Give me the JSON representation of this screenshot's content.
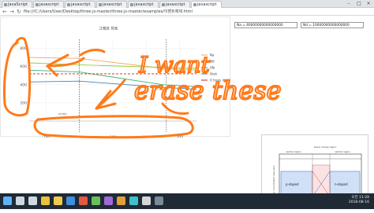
{
  "browser": {
    "tabs": [
      {
        "label": "JavaScript",
        "active": false
      },
      {
        "label": "javascript",
        "active": false
      },
      {
        "label": "javascript",
        "active": false
      },
      {
        "label": "javascript",
        "active": false
      },
      {
        "label": "javascript",
        "active": false
      },
      {
        "label": "javascript",
        "active": false
      },
      {
        "label": "javascript",
        "active": true
      }
    ],
    "address": "file:///C:/Users/User/Desktop/three.js-master/three.js-master/examples/이벤트예제.html",
    "window_controls": {
      "minimize": "–",
      "maximize": "□",
      "close": "×"
    },
    "nav": {
      "back": "←",
      "forward": "→",
      "reload": "↻"
    }
  },
  "chart_data": {
    "type": "line",
    "title": "그래프 차트",
    "x_ticks": [
      "-100",
      "0",
      "100",
      "200",
      "300"
    ],
    "y_ticks": [
      "800",
      "600",
      "400",
      "200"
    ],
    "xlim": [
      -150,
      350
    ],
    "ylim": [
      0,
      900
    ],
    "series": [
      {
        "name": "Na",
        "color": "#f4a460",
        "points": [
          [
            -150,
            700
          ],
          [
            0,
            690
          ],
          [
            250,
            580
          ],
          [
            350,
            560
          ]
        ]
      },
      {
        "name": "Nd",
        "color": "#9acd32",
        "points": [
          [
            -150,
            640
          ],
          [
            0,
            620
          ],
          [
            250,
            590
          ],
          [
            350,
            580
          ]
        ]
      },
      {
        "name": "Vbi",
        "color": "#3cb371",
        "points": [
          [
            -150,
            560
          ],
          [
            0,
            540
          ],
          [
            250,
            400
          ],
          [
            350,
            380
          ]
        ]
      },
      {
        "name": "Vout",
        "color": "#4682b4",
        "points": [
          [
            -150,
            430
          ],
          [
            0,
            440
          ],
          [
            250,
            370
          ],
          [
            350,
            350
          ]
        ]
      },
      {
        "name": "V trans in",
        "color": "#cc2222",
        "dashed": true,
        "points": [
          [
            -150,
            520
          ],
          [
            350,
            520
          ]
        ]
      }
    ],
    "x_axis_label": "x(nm)"
  },
  "inputs": {
    "na": "Na = 40000000000000000",
    "nd": "Nd = 10000000000000000"
  },
  "annotation": {
    "text_line1": "I want",
    "text_line2": "erase these",
    "color": "#ff7a1a"
  },
  "diagram": {
    "label_left": "p-doped",
    "label_right": "n-doped",
    "label_top_left": "neutral region",
    "label_top_mid": "space charge region",
    "label_top_right": "neutral region",
    "y_label": "carrier concentration (log scale)"
  },
  "taskbar": {
    "time": "오전 11:28",
    "date": "2018-08-16",
    "icons": [
      "windows-start",
      "search",
      "task-view",
      "chrome",
      "explorer",
      "app1",
      "app2",
      "app3",
      "app4",
      "app5",
      "app6",
      "app7",
      "app8"
    ]
  }
}
